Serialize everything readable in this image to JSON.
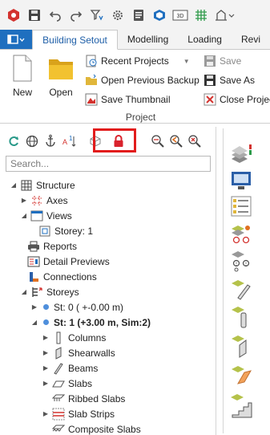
{
  "quick_access": {
    "icons": [
      "app-logo-icon",
      "save-icon",
      "undo-icon",
      "redo-icon",
      "filter-icon",
      "settings-icon",
      "report-icon",
      "cube-icon",
      "3d-view-icon",
      "grid-icon",
      "analysis-icon"
    ],
    "view3d_label": "3D"
  },
  "tabs": [
    "Building Setout",
    "Modelling",
    "Loading",
    "Revi"
  ],
  "ribbon": {
    "new_label": "New",
    "open_label": "Open",
    "recent_projects": "Recent Projects",
    "open_previous_backup": "Open Previous Backup",
    "save_thumbnail": "Save Thumbnail",
    "save": "Save",
    "save_as": "Save As",
    "close_project": "Close Project",
    "group_label": "Project"
  },
  "panel": {
    "search_placeholder": "Search...",
    "sort_label": "A",
    "sort_number": "1"
  },
  "tree": {
    "structure": "Structure",
    "axes": "Axes",
    "views": "Views",
    "storey1": "Storey: 1",
    "reports": "Reports",
    "detail_previews": "Detail Previews",
    "connections": "Connections",
    "storeys": "Storeys",
    "st0": "St: 0 ( +-0.00 m)",
    "st1": "St: 1 (+3.00 m, Sim:2)",
    "columns": "Columns",
    "shearwalls": "Shearwalls",
    "beams": "Beams",
    "slabs": "Slabs",
    "ribbed_slabs": "Ribbed Slabs",
    "slab_strips": "Slab Strips",
    "composite_slabs": "Composite Slabs"
  },
  "colors": {
    "accent": "#1f6fbf",
    "highlight": "#e21c1c",
    "lock": "#d9232d"
  }
}
